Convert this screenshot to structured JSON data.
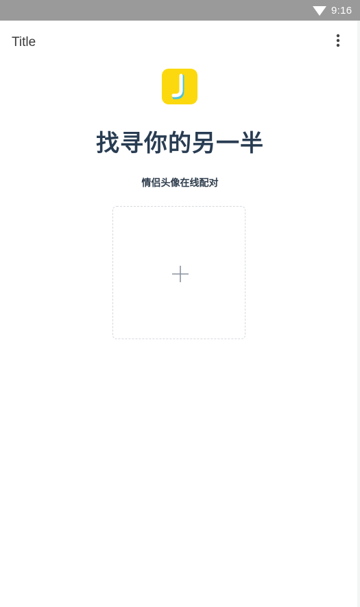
{
  "status_bar": {
    "time": "9:16",
    "icons": [
      "wifi-icon"
    ]
  },
  "app_bar": {
    "title": "Title",
    "menu_icon": "more-vert-icon"
  },
  "logo": {
    "icon": "app-logo-j",
    "letter": "J",
    "color": "#fbd90e"
  },
  "main": {
    "headline": "找寻你的另一半",
    "subline": "情侣头像在线配对",
    "upload": {
      "icon": "plus-icon"
    }
  },
  "colors": {
    "status_bar": "#9a9a9a",
    "headline": "#283c52",
    "logo_bg": "#fbd90e",
    "upload_border": "#d6d9de"
  }
}
